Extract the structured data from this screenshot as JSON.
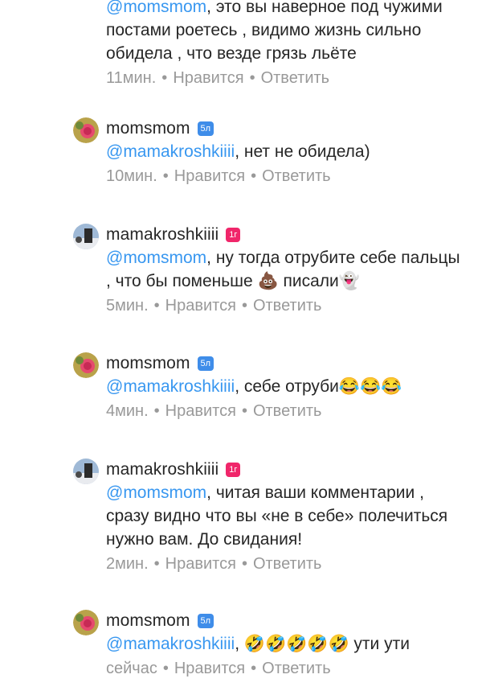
{
  "comments": [
    {
      "username": "",
      "badge": "",
      "mention": "@momsmom",
      "text": ", это вы наверное под чужими постами роетесь , видимо жизнь сильно обидела , что везде грязь льёте",
      "time": "11мин.",
      "like": "Нравится",
      "reply": "Ответить"
    },
    {
      "username": "momsmom",
      "badge": "5л",
      "mention": "@mamakroshkiiii",
      "text": ", нет не обидела)",
      "time": "10мин.",
      "like": "Нравится",
      "reply": "Ответить"
    },
    {
      "username": "mamakroshkiiii",
      "badge": "1г",
      "mention": "@momsmom",
      "text": ", ну тогда отрубите себе пальцы , что бы поменьше 💩 писали👻",
      "time": "5мин.",
      "like": "Нравится",
      "reply": "Ответить"
    },
    {
      "username": "momsmom",
      "badge": "5л",
      "mention": "@mamakroshkiiii",
      "text": ", себе отруби😂😂😂",
      "time": "4мин.",
      "like": "Нравится",
      "reply": "Ответить"
    },
    {
      "username": "mamakroshkiiii",
      "badge": "1г",
      "mention": "@momsmom",
      "text": ", читая ваши комментарии , сразу видно что вы «не в себе» полечиться нужно вам. До свидания!",
      "time": "2мин.",
      "like": "Нравится",
      "reply": "Ответить"
    },
    {
      "username": "momsmom",
      "badge": "5л",
      "mention": "@mamakroshkiiii",
      "text": ", 🤣🤣🤣🤣🤣 ути ути",
      "time": "сейчас",
      "like": "Нравится",
      "reply": "Ответить"
    }
  ],
  "colors": {
    "mention": "#3897f0",
    "meta": "#999999",
    "badge_blue": "#3f8de9",
    "badge_pink": "#f0266a"
  },
  "icons": {
    "momsmom_avatar": "rose-avatar",
    "mamakroshkiiii_avatar": "beach-photo-avatar"
  }
}
